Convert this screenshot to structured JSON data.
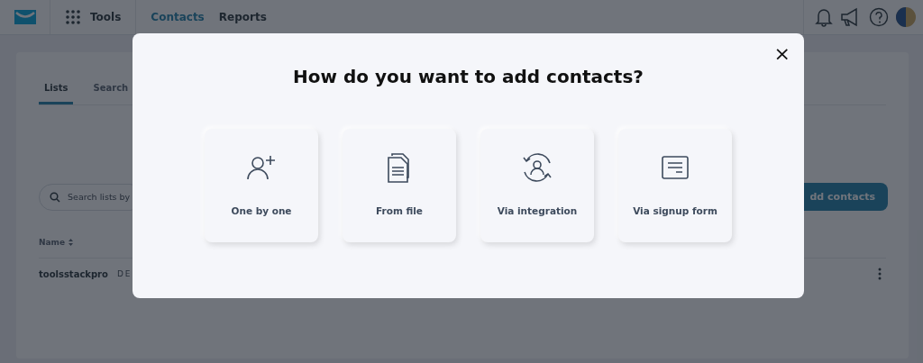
{
  "topbar": {
    "tools": "Tools",
    "nav": [
      {
        "label": "Contacts",
        "selected": true
      },
      {
        "label": "Reports",
        "selected": false
      }
    ]
  },
  "page": {
    "tabs": [
      {
        "label": "Lists",
        "selected": true
      },
      {
        "label": "Search",
        "selected": false
      }
    ],
    "search": {
      "placeholder": "Search lists by"
    },
    "add_button": "dd contacts",
    "table": {
      "columns": [
        "Name"
      ],
      "rows": [
        {
          "name": "toolsstackpro",
          "column_2": "DE"
        }
      ]
    }
  },
  "modal": {
    "title": "How do you want to add contacts?",
    "close": "×",
    "options": [
      {
        "kind": "person-add",
        "label": "One by one"
      },
      {
        "kind": "file",
        "label": "From file"
      },
      {
        "kind": "integration",
        "label": "Via integration"
      },
      {
        "kind": "form",
        "label": "Via signup form"
      }
    ]
  }
}
